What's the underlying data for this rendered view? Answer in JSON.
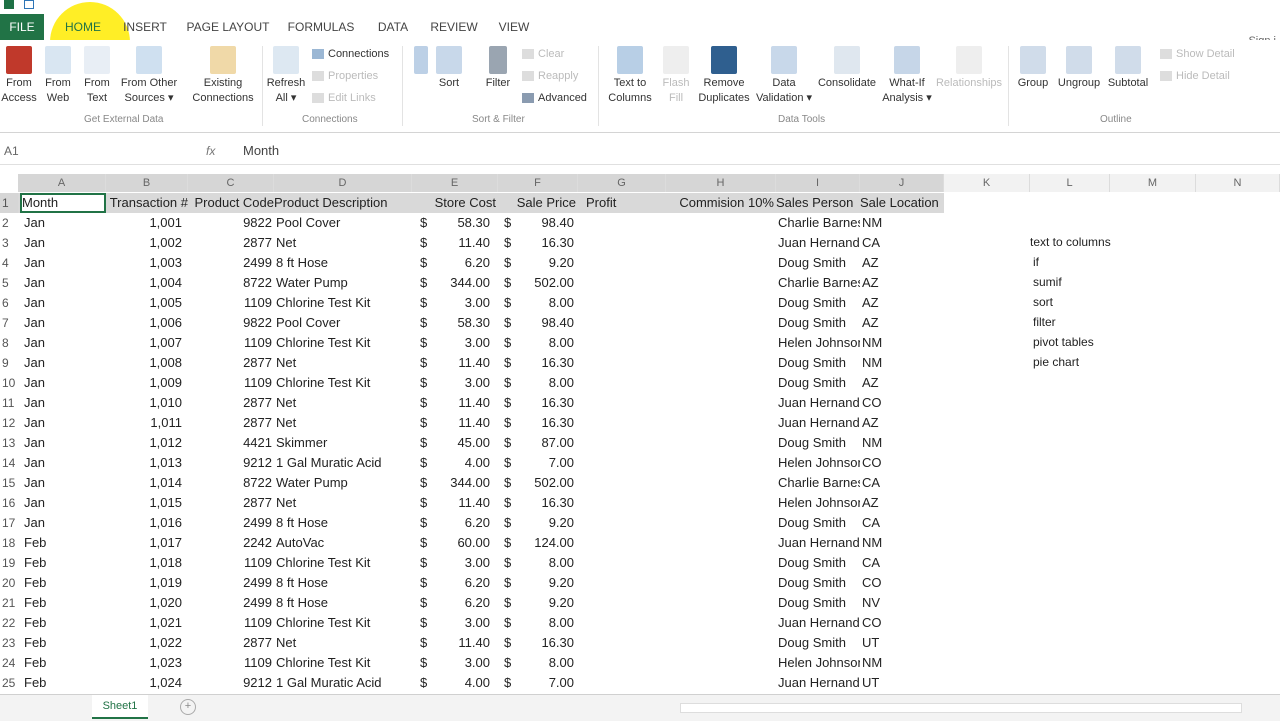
{
  "tabs": [
    "FILE",
    "HOME",
    "INSERT",
    "PAGE LAYOUT",
    "FORMULAS",
    "DATA",
    "REVIEW",
    "VIEW"
  ],
  "signin": "Sign i",
  "ribbon": {
    "from_access": "From\nAccess",
    "from_web": "From\nWeb",
    "from_text": "From\nText",
    "from_other": "From Other\nSources ▾",
    "existing": "Existing\nConnections",
    "refresh": "Refresh\nAll ▾",
    "connections": "Connections",
    "properties": "Properties",
    "edit_links": "Edit Links",
    "sort": "Sort",
    "filter": "Filter",
    "clear": "Clear",
    "reapply": "Reapply",
    "advanced": "Advanced",
    "text_to_columns": "Text to\nColumns",
    "flash_fill": "Flash\nFill",
    "remove_duplicates": "Remove\nDuplicates",
    "data_validation": "Data\nValidation ▾",
    "consolidate": "Consolidate",
    "whatif": "What-If\nAnalysis ▾",
    "relationships": "Relationships",
    "group": "Group",
    "ungroup": "Ungroup",
    "subtotal": "Subtotal",
    "show_detail": "Show Detail",
    "hide_detail": "Hide Detail",
    "g_external": "Get External Data",
    "g_connections": "Connections",
    "g_sort": "Sort & Filter",
    "g_tools": "Data Tools",
    "g_outline": "Outline"
  },
  "formula_bar": {
    "name_box": "A1",
    "fx": "fx",
    "content": "Month"
  },
  "columns": [
    "A",
    "B",
    "C",
    "D",
    "E",
    "F",
    "G",
    "H",
    "I",
    "J",
    "K",
    "L",
    "M",
    "N"
  ],
  "header_row": [
    "Month",
    "Transaction #",
    "Product Code",
    "Product Description",
    "Store Cost",
    "Sale Price",
    "Profit",
    "Commision 10%",
    "Sales Person",
    "Sale Location"
  ],
  "rows": [
    [
      "2",
      "Jan",
      "1,001",
      "9822",
      "Pool Cover",
      "58.30",
      "98.40",
      "Charlie Barnes",
      "NM"
    ],
    [
      "3",
      "Jan",
      "1,002",
      "2877",
      "Net",
      "11.40",
      "16.30",
      "Juan Hernandez",
      "CA"
    ],
    [
      "4",
      "Jan",
      "1,003",
      "2499",
      "8 ft Hose",
      "6.20",
      "9.20",
      "Doug Smith",
      "AZ"
    ],
    [
      "5",
      "Jan",
      "1,004",
      "8722",
      "Water Pump",
      "344.00",
      "502.00",
      "Charlie Barnes",
      "AZ"
    ],
    [
      "6",
      "Jan",
      "1,005",
      "1109",
      "Chlorine Test Kit",
      "3.00",
      "8.00",
      "Doug Smith",
      "AZ"
    ],
    [
      "7",
      "Jan",
      "1,006",
      "9822",
      "Pool Cover",
      "58.30",
      "98.40",
      "Doug Smith",
      "AZ"
    ],
    [
      "8",
      "Jan",
      "1,007",
      "1109",
      "Chlorine Test Kit",
      "3.00",
      "8.00",
      "Helen Johnson",
      "NM"
    ],
    [
      "9",
      "Jan",
      "1,008",
      "2877",
      "Net",
      "11.40",
      "16.30",
      "Doug Smith",
      "NM"
    ],
    [
      "10",
      "Jan",
      "1,009",
      "1109",
      "Chlorine Test Kit",
      "3.00",
      "8.00",
      "Doug Smith",
      "AZ"
    ],
    [
      "11",
      "Jan",
      "1,010",
      "2877",
      "Net",
      "11.40",
      "16.30",
      "Juan Hernandez",
      "CO"
    ],
    [
      "12",
      "Jan",
      "1,011",
      "2877",
      "Net",
      "11.40",
      "16.30",
      "Juan Hernandez",
      "AZ"
    ],
    [
      "13",
      "Jan",
      "1,012",
      "4421",
      "Skimmer",
      "45.00",
      "87.00",
      "Doug Smith",
      "NM"
    ],
    [
      "14",
      "Jan",
      "1,013",
      "9212",
      "1 Gal Muratic Acid",
      "4.00",
      "7.00",
      "Helen Johnson",
      "CO"
    ],
    [
      "15",
      "Jan",
      "1,014",
      "8722",
      "Water Pump",
      "344.00",
      "502.00",
      "Charlie Barnes",
      "CA"
    ],
    [
      "16",
      "Jan",
      "1,015",
      "2877",
      "Net",
      "11.40",
      "16.30",
      "Helen Johnson",
      "AZ"
    ],
    [
      "17",
      "Jan",
      "1,016",
      "2499",
      "8 ft Hose",
      "6.20",
      "9.20",
      "Doug Smith",
      "CA"
    ],
    [
      "18",
      "Feb",
      "1,017",
      "2242",
      "AutoVac",
      "60.00",
      "124.00",
      "Juan Hernandez",
      "NM"
    ],
    [
      "19",
      "Feb",
      "1,018",
      "1109",
      "Chlorine Test Kit",
      "3.00",
      "8.00",
      "Doug Smith",
      "CA"
    ],
    [
      "20",
      "Feb",
      "1,019",
      "2499",
      "8 ft Hose",
      "6.20",
      "9.20",
      "Doug Smith",
      "CO"
    ],
    [
      "21",
      "Feb",
      "1,020",
      "2499",
      "8 ft Hose",
      "6.20",
      "9.20",
      "Doug Smith",
      "NV"
    ],
    [
      "22",
      "Feb",
      "1,021",
      "1109",
      "Chlorine Test Kit",
      "3.00",
      "8.00",
      "Juan Hernandez",
      "CO"
    ],
    [
      "23",
      "Feb",
      "1,022",
      "2877",
      "Net",
      "11.40",
      "16.30",
      "Doug Smith",
      "UT"
    ],
    [
      "24",
      "Feb",
      "1,023",
      "1109",
      "Chlorine Test Kit",
      "3.00",
      "8.00",
      "Helen Johnson",
      "NM"
    ],
    [
      "25",
      "Feb",
      "1,024",
      "9212",
      "1 Gal Muratic Acid",
      "4.00",
      "7.00",
      "Juan Hernandez",
      "UT"
    ]
  ],
  "currency": "$",
  "notes": [
    "text to columns",
    "if",
    "sumif",
    "sort",
    "filter",
    "pivot tables",
    "pie chart"
  ],
  "sheet_tab": "Sheet1",
  "add_sheet": "+"
}
